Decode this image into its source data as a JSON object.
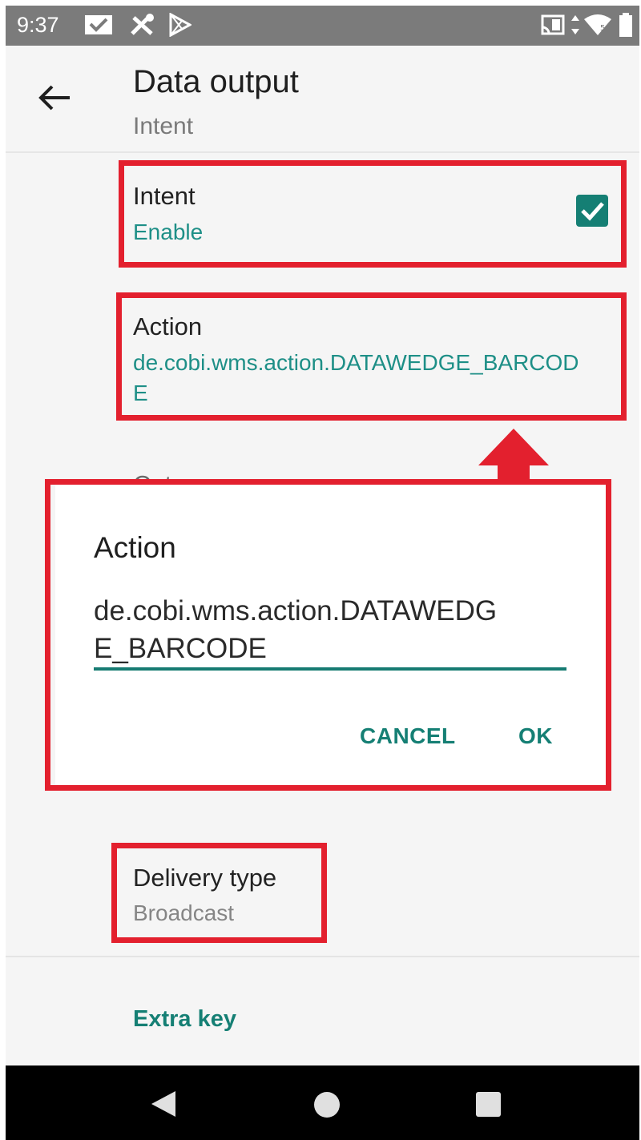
{
  "status_bar": {
    "time": "9:37",
    "icons": [
      "mail-check-icon",
      "tools-icon",
      "play-store-icon",
      "cast-icon",
      "data-arrows-icon",
      "wifi-icon",
      "battery-icon"
    ]
  },
  "app_bar": {
    "title": "Data output",
    "subtitle": "Intent",
    "back_icon": "arrow-left-icon"
  },
  "prefs": {
    "intent": {
      "title": "Intent",
      "summary": "Enable",
      "checked": true
    },
    "action": {
      "title": "Action",
      "summary_line1": "de.cobi.wms.action.DATAWEDGE_BARCOD",
      "summary_line2": "E"
    },
    "category_partial": "Cat",
    "delivery": {
      "title": "Delivery type",
      "summary": "Broadcast"
    },
    "extra_key": {
      "title": "Extra key"
    }
  },
  "dialog": {
    "title": "Action",
    "input_line1": "de.cobi.wms.action.DATAWEDG",
    "input_line2": "E_BARCODE",
    "cancel_label": "CANCEL",
    "ok_label": "OK"
  },
  "colors": {
    "accent": "#157f74",
    "highlight": "#e3202e",
    "status_bar": "#7b7b7b"
  },
  "nav_bar": {
    "icons": [
      "nav-back-icon",
      "nav-home-icon",
      "nav-recents-icon"
    ]
  }
}
